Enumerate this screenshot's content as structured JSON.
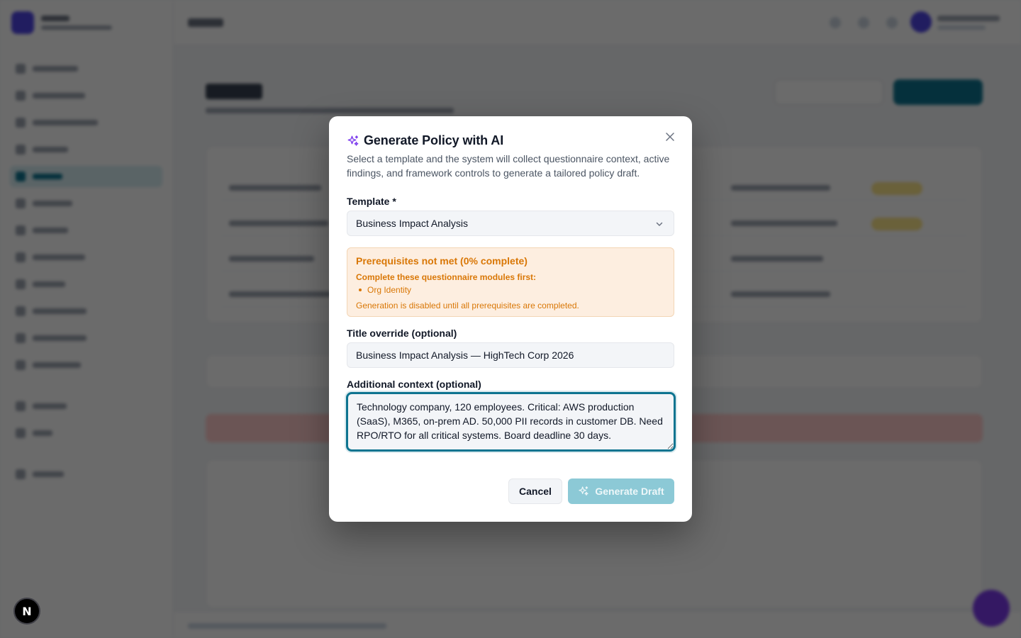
{
  "modal": {
    "title": "Generate Policy with AI",
    "description": "Select a template and the system will collect questionnaire context, active findings, and framework controls to generate a tailored policy draft.",
    "close_icon": "close-icon",
    "title_icon": "sparkles-icon",
    "accent_color": "#7c3aed"
  },
  "template": {
    "label": "Template *",
    "selected": "Business Impact Analysis"
  },
  "prerequisites": {
    "title": "Prerequisites not met (0% complete)",
    "subtitle": "Complete these questionnaire modules first:",
    "modules": [
      "Org Identity"
    ],
    "footer": "Generation is disabled until all prerequisites are completed.",
    "color": "#d97706",
    "percent_complete": 0
  },
  "title_override": {
    "label": "Title override (optional)",
    "value": "Business Impact Analysis — HighTech Corp 2026"
  },
  "additional_context": {
    "label": "Additional context (optional)",
    "value": "Technology company, 120 employees. Critical: AWS production (SaaS), M365, on-prem AD. 50,000 PII records in customer DB. Need RPO/RTO for all critical systems. Board deadline 30 days."
  },
  "actions": {
    "cancel_label": "Cancel",
    "generate_label": "Generate Draft",
    "generate_disabled": true,
    "primary_color": "#0e7490"
  },
  "dev_indicator": {
    "label": "N"
  }
}
